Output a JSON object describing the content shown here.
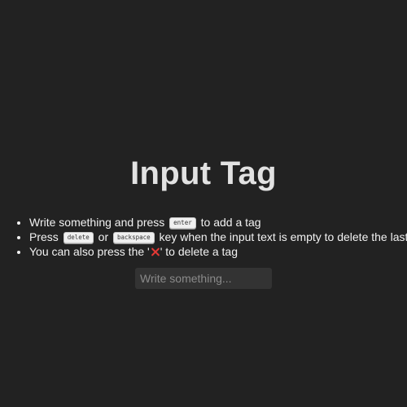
{
  "header": {
    "title": "Input Tag"
  },
  "instructions": {
    "line1": {
      "before": "Write something and press",
      "key": "enter",
      "after": "to add a tag"
    },
    "line2": {
      "before": "Press",
      "key1": "delete",
      "middle": "or",
      "key2": "backspace",
      "after": "key when the input text is empty to delete the last tag"
    },
    "line3": {
      "before": "You can also press the '",
      "icon": "close-icon",
      "after": "' to delete a tag"
    }
  },
  "input": {
    "value": "",
    "placeholder": "Write something..."
  },
  "colors": {
    "background": "#222222",
    "title": "#e2e2e2",
    "input_background": "#333333",
    "close_icon": "#e53935"
  }
}
